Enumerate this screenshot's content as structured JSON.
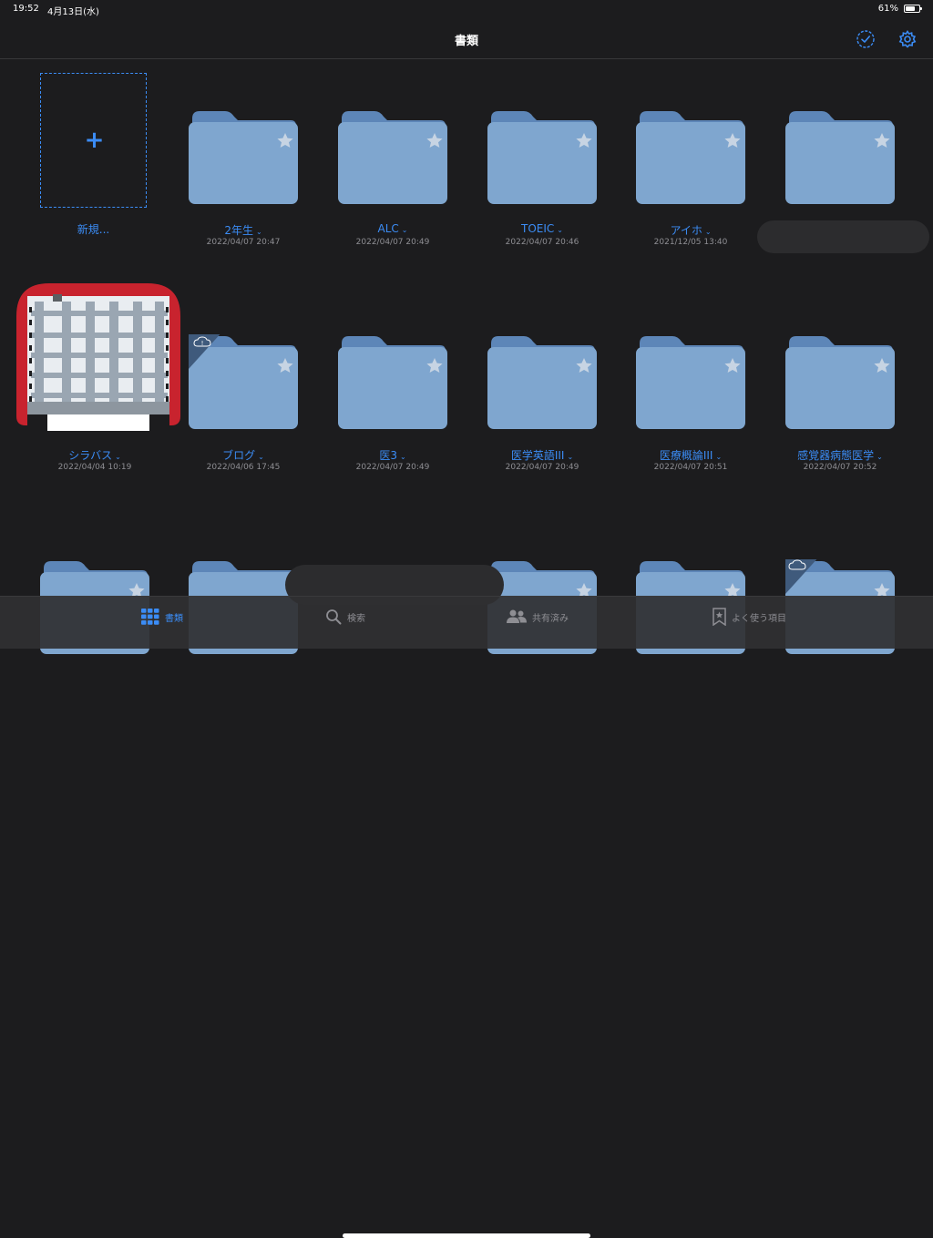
{
  "status": {
    "time": "19:52",
    "date": "4月13日(水)",
    "battery": "61%"
  },
  "nav": {
    "title": "書類",
    "select_icon": "checkmark-circle-icon",
    "settings_icon": "gear-icon"
  },
  "colors": {
    "accent": "#3b8cf5",
    "folder": "#7fa6cf",
    "folder_tab": "#5d86b8",
    "background": "#1c1c1e"
  },
  "new_item": {
    "label": "新規..."
  },
  "row1": [
    {
      "name": "2年生",
      "date": "2022/04/07 20:47"
    },
    {
      "name": "ALC",
      "date": "2022/04/07 20:49"
    },
    {
      "name": "TOEIC",
      "date": "2022/04/07 20:46"
    },
    {
      "name": "アイホ",
      "date": "2021/12/05 13:40"
    },
    {
      "name": "",
      "date": ""
    }
  ],
  "row2": [
    {
      "name": "シラバス",
      "date": "2022/04/04 10:19"
    },
    {
      "name": "ブログ",
      "date": "2022/04/06 17:45"
    },
    {
      "name": "医3",
      "date": "2022/04/07 20:49"
    },
    {
      "name": "医学英語III",
      "date": "2022/04/07 20:49"
    },
    {
      "name": "医療概論III",
      "date": "2022/04/07 20:51"
    },
    {
      "name": "感覚器病態医学",
      "date": "2022/04/07 20:52"
    }
  ],
  "tabs": [
    {
      "label": "書類",
      "icon": "grid-icon",
      "active": true
    },
    {
      "label": "検索",
      "icon": "search-icon",
      "active": false
    },
    {
      "label": "共有済み",
      "icon": "people-icon",
      "active": false
    },
    {
      "label": "よく使う項目",
      "icon": "bookmark-star-icon",
      "active": false
    }
  ]
}
